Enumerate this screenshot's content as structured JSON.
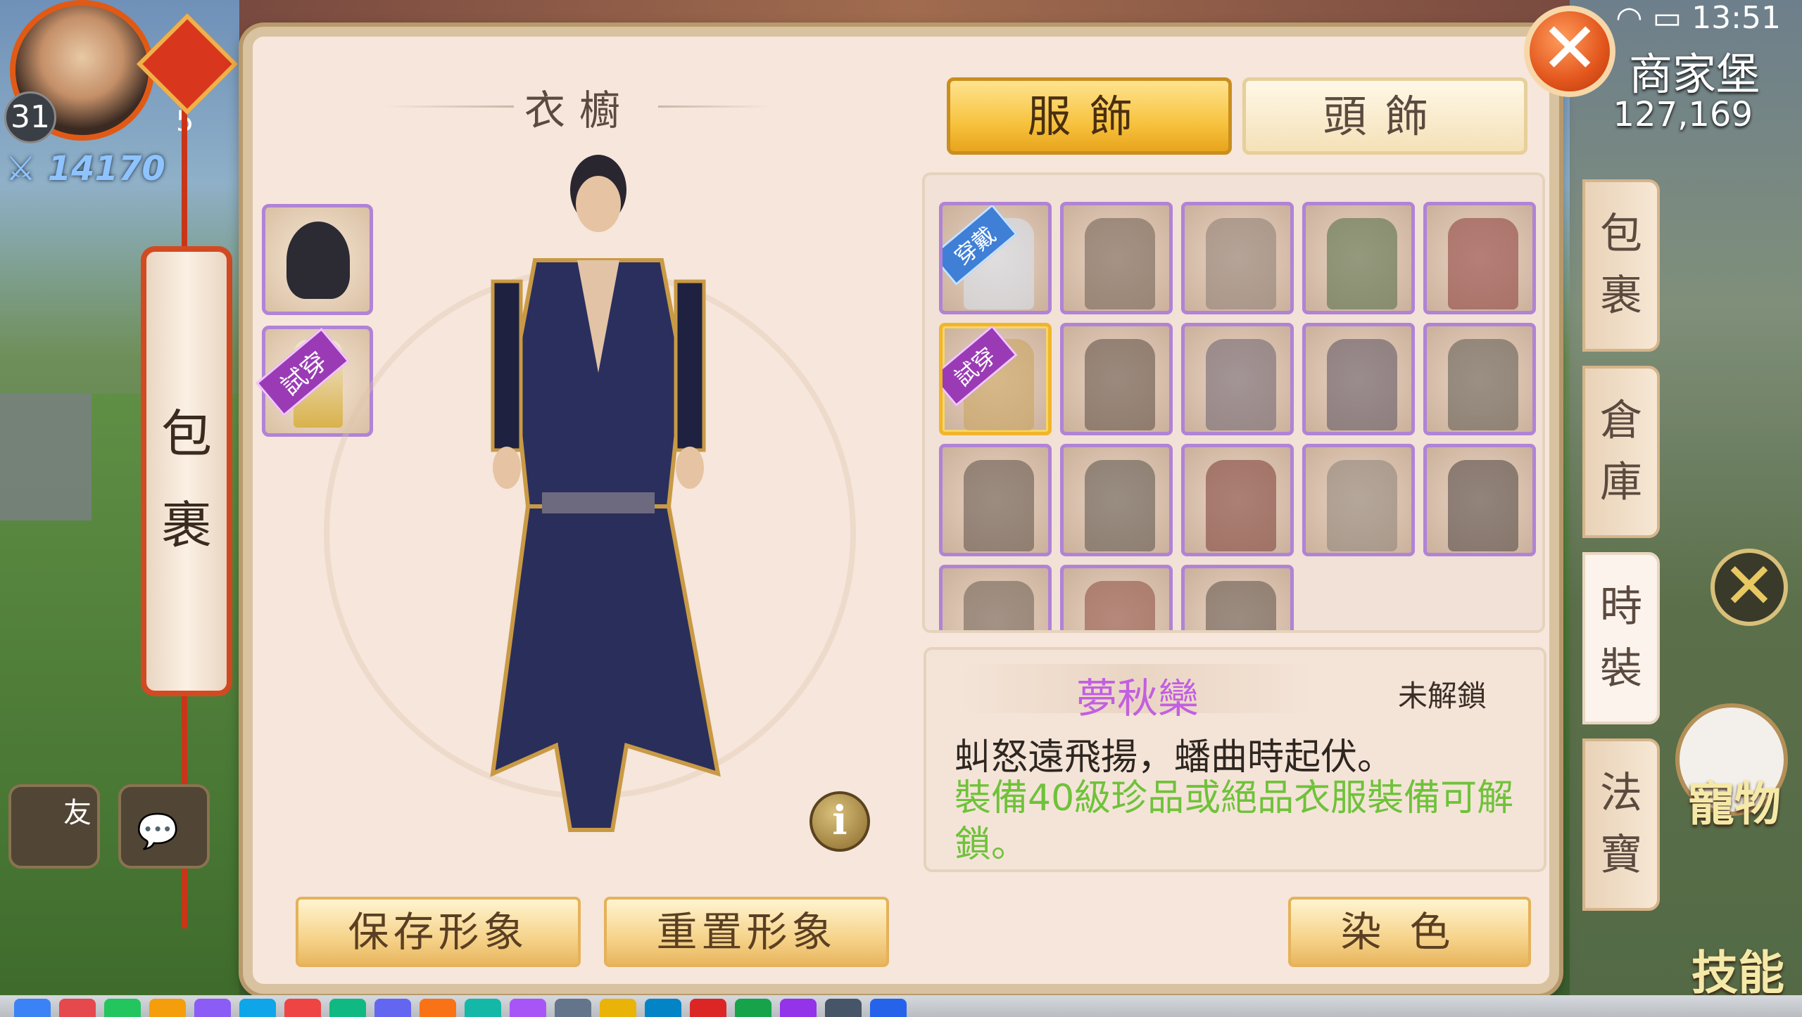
{
  "status_bar": {
    "time": "13:51"
  },
  "hud": {
    "player_level": "31",
    "secondary_level": "5",
    "power": "14170",
    "map_name": "商家堡",
    "coordinates": "127,169",
    "bag_scroll": [
      "包",
      "裹"
    ],
    "pet_label": "寵物",
    "skill_label": "技能",
    "friend_label": "友"
  },
  "wardrobe": {
    "title": "衣櫥",
    "tabs": [
      {
        "label": "服飾",
        "active": true
      },
      {
        "label": "頭飾",
        "active": false
      }
    ],
    "equipped": [
      {
        "type": "hair",
        "badge": ""
      },
      {
        "type": "outfit",
        "badge": "試穿"
      }
    ],
    "grid": [
      {
        "badge": "穿戴",
        "tint": "#d9e6f5",
        "selected": false
      },
      {
        "badge": "",
        "tint": "#6e5c52",
        "selected": false
      },
      {
        "badge": "",
        "tint": "#8a7c72",
        "selected": false
      },
      {
        "badge": "",
        "tint": "#4e6a44",
        "selected": false
      },
      {
        "badge": "",
        "tint": "#8a3a3a",
        "selected": false
      },
      {
        "badge": "試穿",
        "tint": "#c9a25a",
        "selected": true
      },
      {
        "badge": "",
        "tint": "#5b4d44",
        "selected": false
      },
      {
        "badge": "",
        "tint": "#6a6070",
        "selected": false
      },
      {
        "badge": "",
        "tint": "#5a5060",
        "selected": false
      },
      {
        "badge": "",
        "tint": "#5b5750",
        "selected": false
      },
      {
        "badge": "",
        "tint": "#5c5048",
        "selected": false
      },
      {
        "badge": "",
        "tint": "#58524a",
        "selected": false
      },
      {
        "badge": "",
        "tint": "#7a3a34",
        "selected": false
      },
      {
        "badge": "",
        "tint": "#8a8278",
        "selected": false
      },
      {
        "badge": "",
        "tint": "#4a4240",
        "selected": false
      },
      {
        "badge": "",
        "tint": "#6a5c52",
        "selected": false
      },
      {
        "badge": "",
        "tint": "#8a4a40",
        "selected": false
      },
      {
        "badge": "",
        "tint": "#5c5048",
        "selected": false
      }
    ],
    "item": {
      "name": "夢秋欒",
      "state": "未解鎖",
      "description": "虯怒遠飛揚，蟠曲時起伏。",
      "unlock_hint": "裝備40級珍品或絕品衣服裝備可解鎖。"
    },
    "buttons": {
      "save": "保存形象",
      "reset": "重置形象",
      "dye": "染色",
      "info": "i"
    },
    "side_tabs": [
      {
        "label": [
          "包",
          "裹"
        ],
        "active": false
      },
      {
        "label": [
          "倉",
          "庫"
        ],
        "active": false
      },
      {
        "label": [
          "時",
          "裝"
        ],
        "active": true
      },
      {
        "label": [
          "法",
          "寶"
        ],
        "active": false
      }
    ]
  },
  "colors": {
    "accent": "#f7c33f",
    "slot_border": "#b083d6",
    "unlock_hint": "#6fc23a",
    "item_name": "#c25fe0"
  },
  "icons": [
    "close-icon",
    "info-icon",
    "wifi-icon",
    "battery-icon"
  ]
}
